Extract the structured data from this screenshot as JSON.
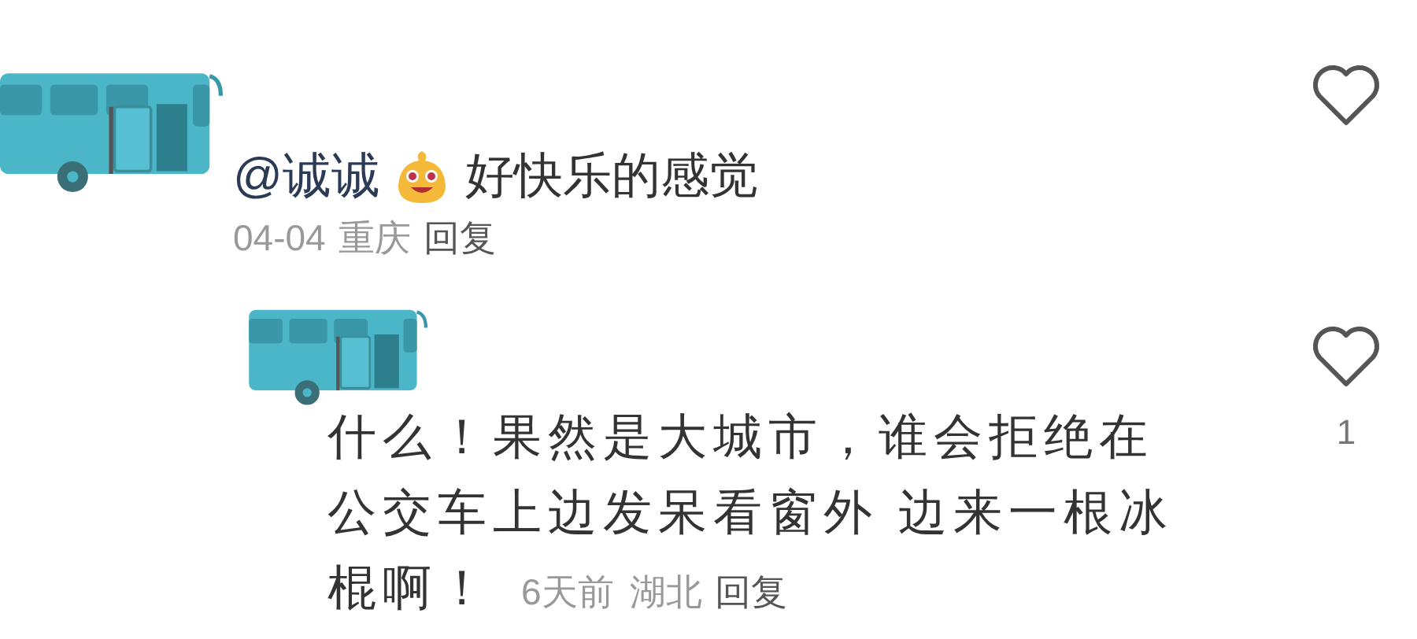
{
  "comments": [
    {
      "mention": "@诚诚",
      "text": "好快乐的感觉",
      "time": "04-04",
      "location": "重庆",
      "reply": "回复",
      "children": [
        {
          "text_lines": [
            "什么！果然是大城市，谁会拒绝在",
            "公交车上边发呆看窗外 边来一根冰",
            "棍啊！"
          ],
          "time": "6天前",
          "location": "湖北",
          "reply": "回复",
          "like_count": "1"
        }
      ]
    }
  ]
}
